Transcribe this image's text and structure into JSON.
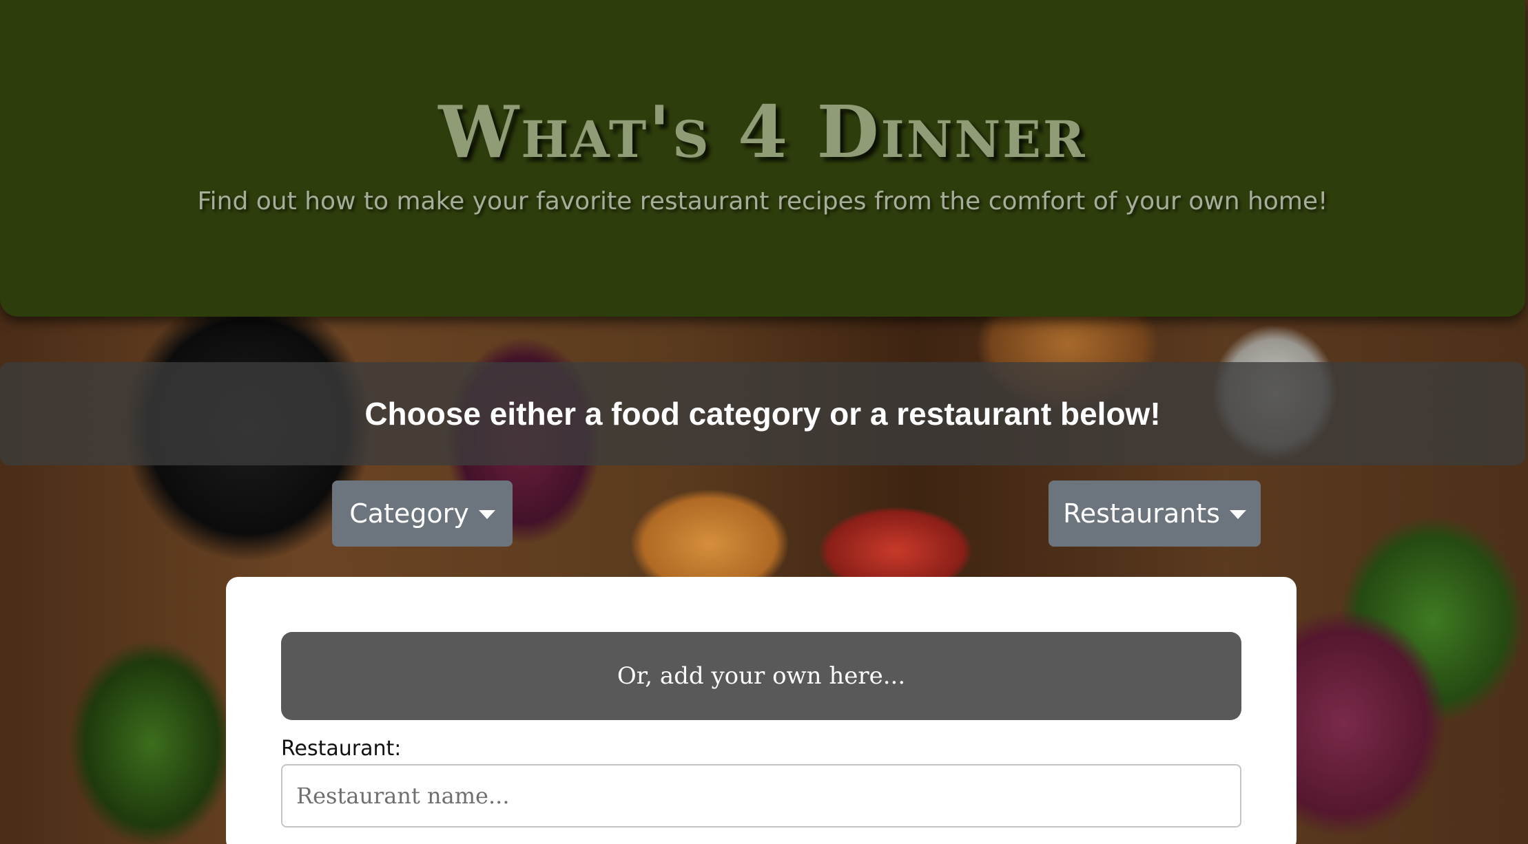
{
  "header": {
    "title": "What's 4 Dinner",
    "tagline": "Find out how to make your favorite restaurant recipes from the comfort of your own home!"
  },
  "prompt": {
    "text": "Choose either a food category or a restaurant below!"
  },
  "dropdowns": {
    "category_label": "Category",
    "restaurants_label": "Restaurants"
  },
  "form": {
    "banner": "Or, add your own here...",
    "restaurant_label": "Restaurant:",
    "restaurant_placeholder": "Restaurant name..."
  },
  "colors": {
    "header_bg": "#2e3d0c",
    "title_color": "#8f9c75",
    "button_bg": "#6c757d",
    "banner_bg": "#595959"
  },
  "icons": {
    "dropdown_caret": "caret-down-icon"
  }
}
